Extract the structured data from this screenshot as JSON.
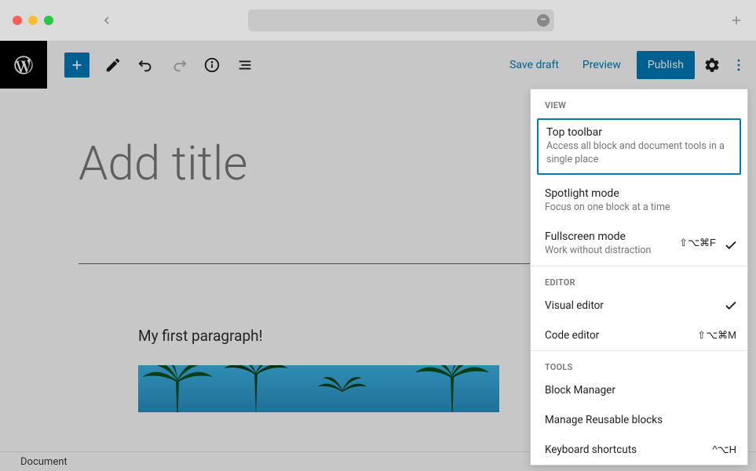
{
  "browser": {
    "url": ""
  },
  "toolbar": {
    "save_draft": "Save draft",
    "preview": "Preview",
    "publish": "Publish"
  },
  "canvas": {
    "title_placeholder": "Add title",
    "paragraph": "My first paragraph!"
  },
  "footer": {
    "breadcrumb": "Document"
  },
  "dropdown": {
    "sections": {
      "view": {
        "label": "VIEW",
        "items": [
          {
            "title": "Top toolbar",
            "desc": "Access all block and document tools in a single place",
            "highlighted": true
          },
          {
            "title": "Spotlight mode",
            "desc": "Focus on one block at a time"
          },
          {
            "title": "Fullscreen mode",
            "desc": "Work without distraction",
            "shortcut": "⇧⌥⌘F",
            "checked": true
          }
        ]
      },
      "editor": {
        "label": "EDITOR",
        "items": [
          {
            "title": "Visual editor",
            "checked": true
          },
          {
            "title": "Code editor",
            "shortcut": "⇧⌥⌘M"
          }
        ]
      },
      "tools": {
        "label": "TOOLS",
        "items": [
          {
            "title": "Block Manager"
          },
          {
            "title": "Manage Reusable blocks"
          },
          {
            "title": "Keyboard shortcuts",
            "shortcut": "^⌥H"
          }
        ]
      }
    }
  }
}
